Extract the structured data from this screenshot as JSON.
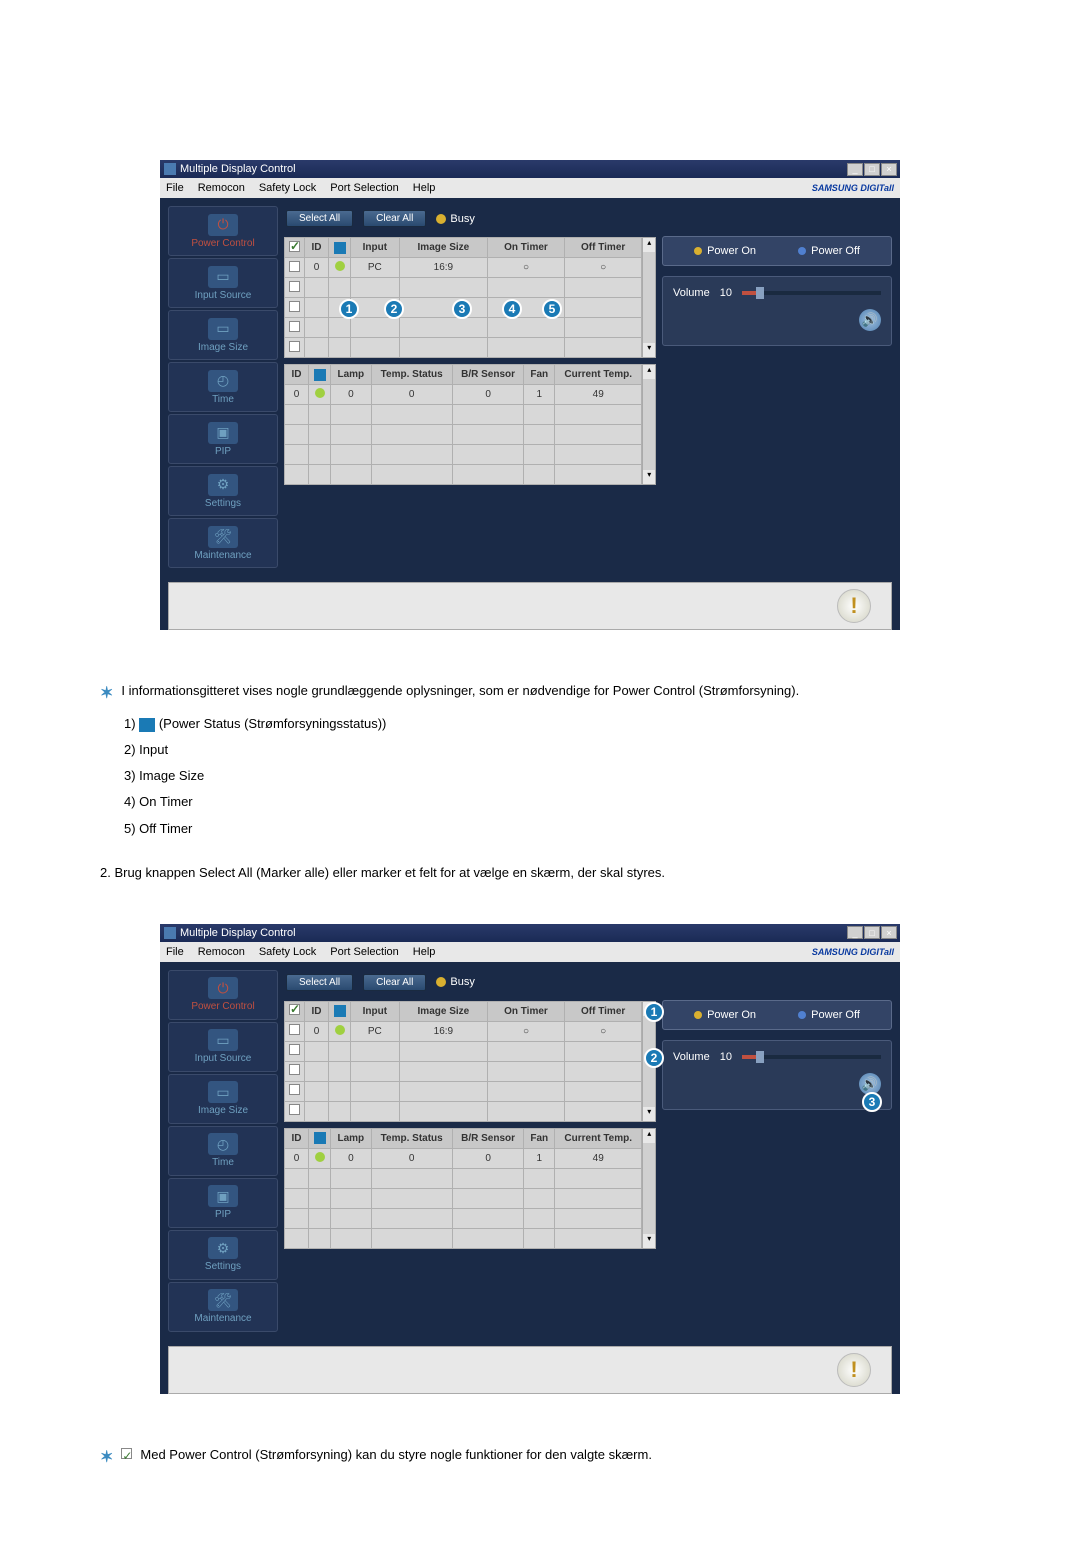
{
  "app": {
    "title": "Multiple Display Control",
    "menus": [
      "File",
      "Remocon",
      "Safety Lock",
      "Port Selection",
      "Help"
    ],
    "brand": "SAMSUNG DIGITall"
  },
  "sidebar": [
    {
      "label": "Power Control",
      "active": true
    },
    {
      "label": "Input Source",
      "active": false
    },
    {
      "label": "Image Size",
      "active": false
    },
    {
      "label": "Time",
      "active": false
    },
    {
      "label": "PIP",
      "active": false
    },
    {
      "label": "Settings",
      "active": false
    },
    {
      "label": "Maintenance",
      "active": false
    }
  ],
  "toolbar": {
    "select_all": "Select All",
    "clear_all": "Clear All",
    "busy": "Busy"
  },
  "table1": {
    "headers": [
      "",
      "ID",
      "",
      "Input",
      "Image Size",
      "On Timer",
      "Off Timer"
    ],
    "rows": [
      {
        "checked": true,
        "id": "0",
        "pw": "green",
        "input": "PC",
        "size": "16:9",
        "ontimer": "○",
        "offtimer": "○"
      },
      {
        "checked": false,
        "id": "",
        "pw": "",
        "input": "",
        "size": "",
        "ontimer": "",
        "offtimer": ""
      },
      {
        "checked": false,
        "id": "",
        "pw": "",
        "input": "",
        "size": "",
        "ontimer": "",
        "offtimer": ""
      },
      {
        "checked": false,
        "id": "",
        "pw": "",
        "input": "",
        "size": "",
        "ontimer": "",
        "offtimer": ""
      },
      {
        "checked": false,
        "id": "",
        "pw": "",
        "input": "",
        "size": "",
        "ontimer": "",
        "offtimer": ""
      }
    ]
  },
  "table2": {
    "headers": [
      "ID",
      "",
      "Lamp",
      "Temp. Status",
      "B/R Sensor",
      "Fan",
      "Current Temp."
    ],
    "rows": [
      {
        "id": "0",
        "pw": "green",
        "lamp": "0",
        "temp": "0",
        "sensor": "0",
        "fan": "1",
        "ct": "49"
      },
      {
        "id": "",
        "pw": "",
        "lamp": "",
        "temp": "",
        "sensor": "",
        "fan": "",
        "ct": ""
      },
      {
        "id": "",
        "pw": "",
        "lamp": "",
        "temp": "",
        "sensor": "",
        "fan": "",
        "ct": ""
      },
      {
        "id": "",
        "pw": "",
        "lamp": "",
        "temp": "",
        "sensor": "",
        "fan": "",
        "ct": ""
      },
      {
        "id": "",
        "pw": "",
        "lamp": "",
        "temp": "",
        "sensor": "",
        "fan": "",
        "ct": ""
      }
    ]
  },
  "right": {
    "power_on": "Power On",
    "power_off": "Power Off",
    "volume_label": "Volume",
    "volume_value": "10"
  },
  "callouts1": [
    "1",
    "2",
    "3",
    "4",
    "5"
  ],
  "callouts2": [
    "1",
    "2",
    "3"
  ],
  "text": {
    "para1": "I informationsgitteret vises nogle grundlæggende oplysninger, som er nødvendige for Power Control (Strømforsyning).",
    "l1": "1)",
    "l1b": "(Power Status (Strømforsyningsstatus))",
    "l2": "2) Input",
    "l3": "3) Image Size",
    "l4": "4) On Timer",
    "l5": "5) Off Timer",
    "para2": "2.  Brug knappen Select All (Marker alle) eller marker et felt for at vælge en skærm, der skal styres.",
    "para3": "Med Power Control (Strømforsyning) kan du styre nogle funktioner for den valgte skærm."
  }
}
